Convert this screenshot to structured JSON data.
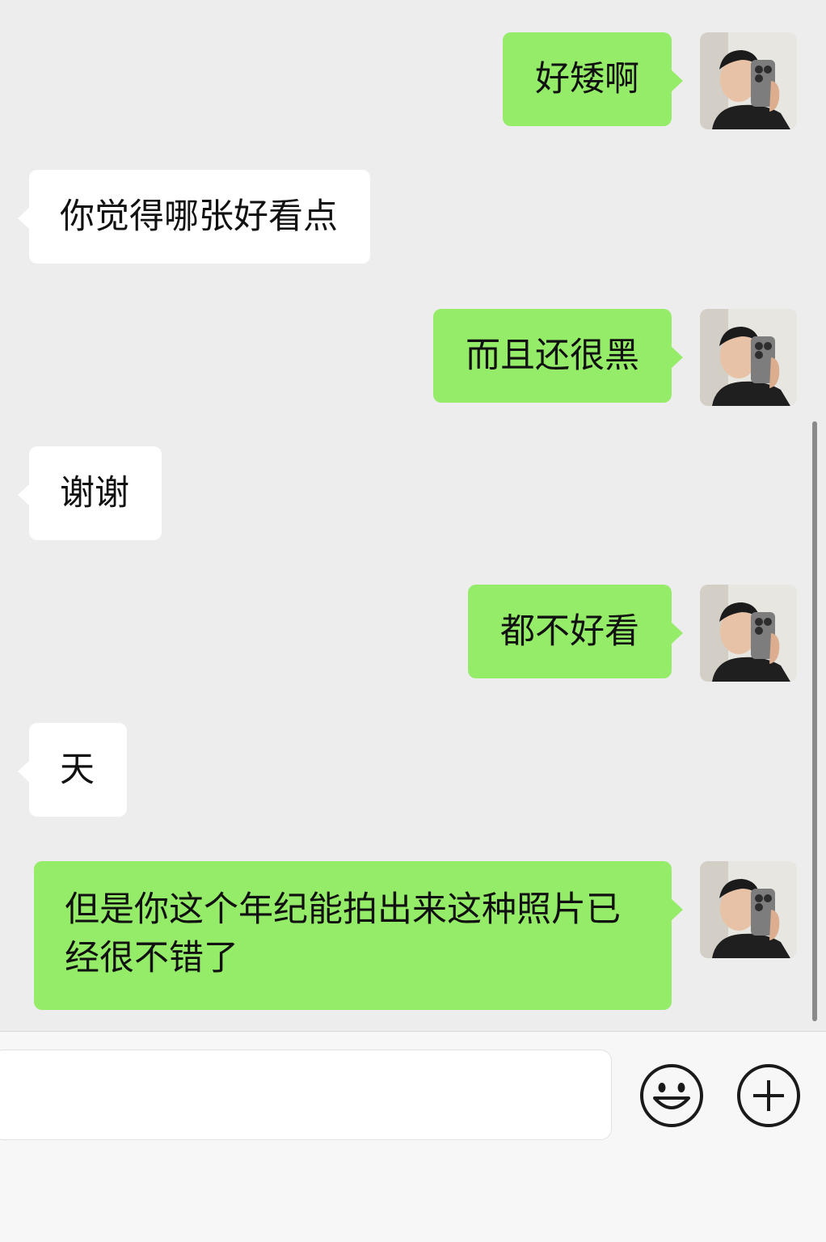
{
  "messages": [
    {
      "sender": "me",
      "text": "好矮啊"
    },
    {
      "sender": "them",
      "text": "你觉得哪张好看点"
    },
    {
      "sender": "me",
      "text": "而且还很黑"
    },
    {
      "sender": "them",
      "text": "谢谢"
    },
    {
      "sender": "me",
      "text": "都不好看"
    },
    {
      "sender": "them",
      "text": "天"
    },
    {
      "sender": "me",
      "text": "但是你这个年纪能拍出来这种照片已经很不错了"
    }
  ],
  "input": {
    "value": ""
  },
  "toolbar": {
    "icons": [
      "emoji-icon",
      "plus-icon"
    ]
  },
  "colors": {
    "my_bubble": "#95ec69",
    "their_bubble": "#ffffff",
    "background": "#ededed"
  }
}
